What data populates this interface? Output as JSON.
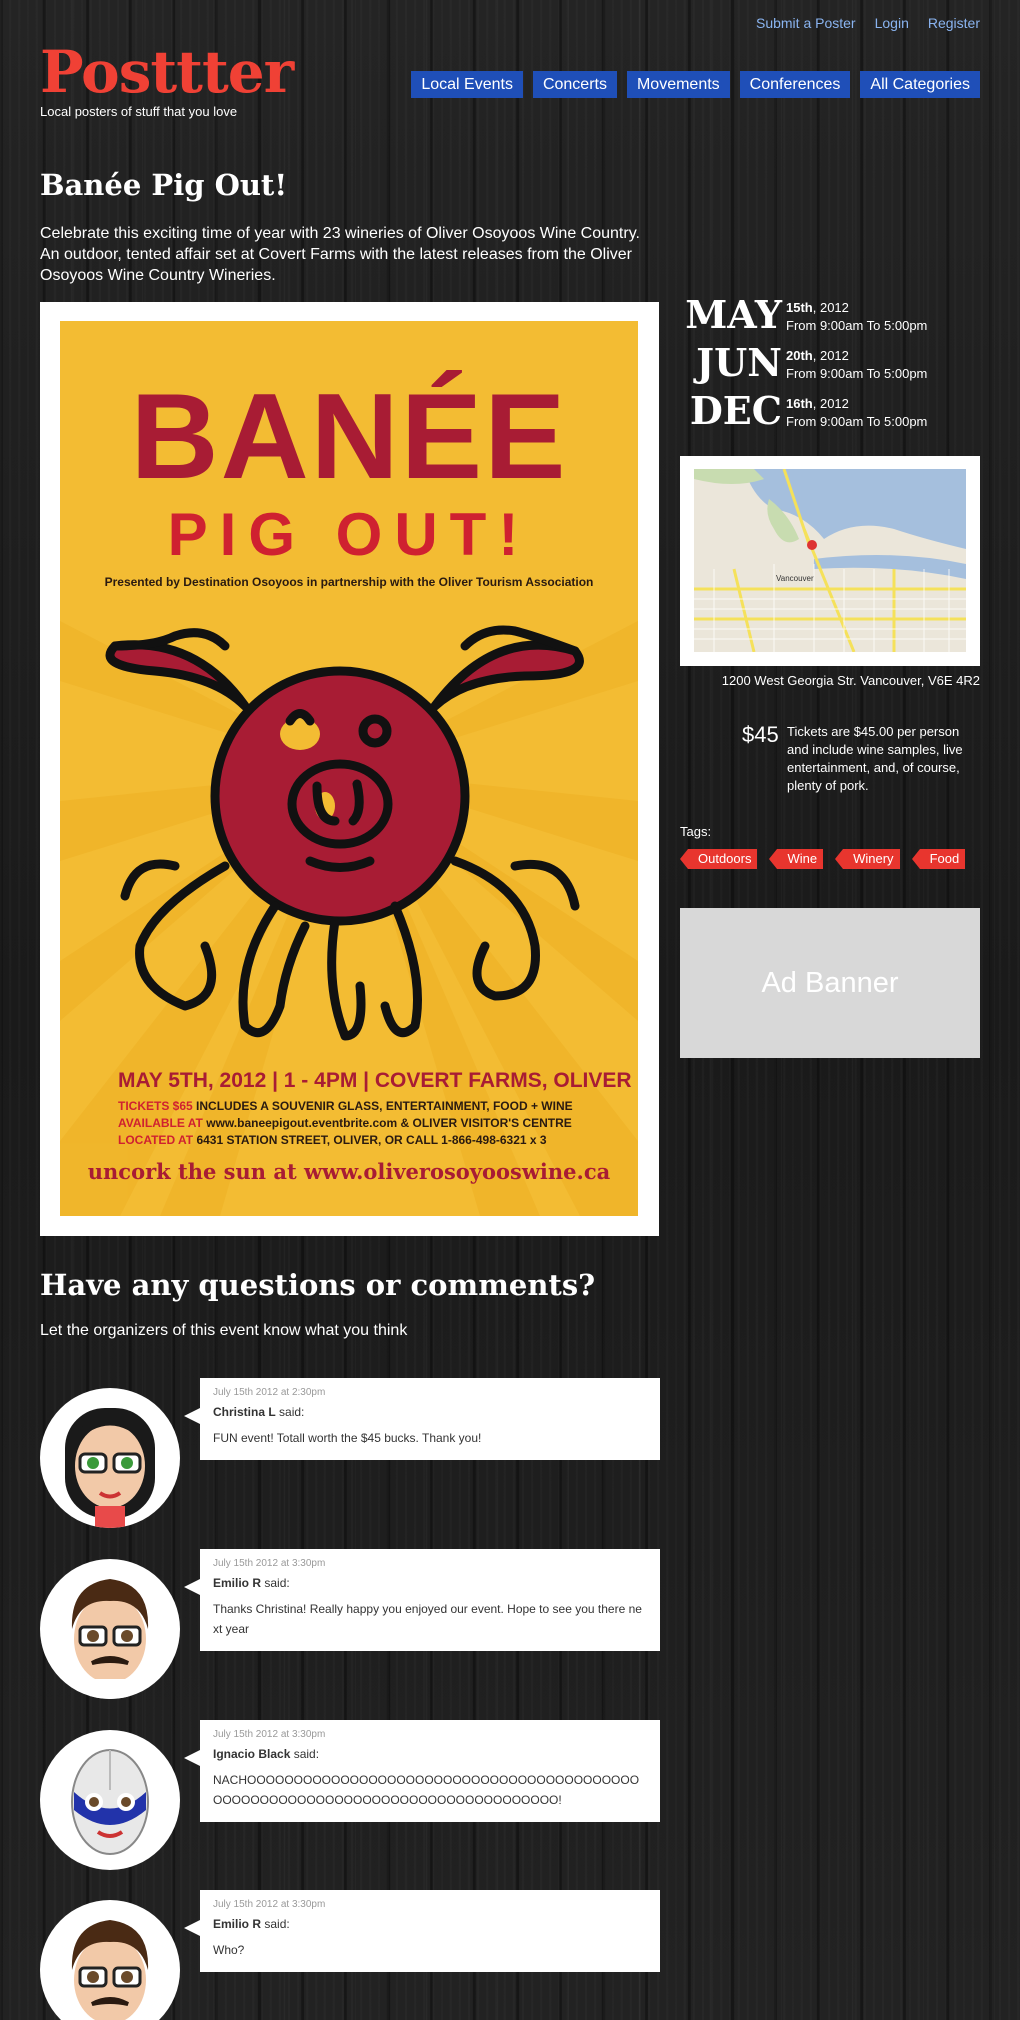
{
  "header": {
    "logo": "Posttter",
    "tagline": "Local posters of stuff that you love",
    "toplinks": [
      "Submit a Poster",
      "Login",
      "Register"
    ],
    "nav": [
      "Local Events",
      "Concerts",
      "Movements",
      "Conferences",
      "All Categories"
    ],
    "colors": {
      "logo": "#f04135",
      "nav": "#1f4fb8",
      "link": "#8ab4f0"
    }
  },
  "event": {
    "title": "Banée Pig Out!",
    "description": "Celebrate this exciting time of year with 23 wineries of Oliver Osoyoos Wine Country. An outdoor, tented affair set at Covert Farms with the latest releases from the Oliver Osoyoos Wine Country Wineries."
  },
  "poster": {
    "title": "BANÉE",
    "subtitle": "PIG OUT!",
    "presented": "Presented by Destination Osoyoos in partnership with the Oliver Tourism Association",
    "line1": "MAY 5TH, 2012 | 1 - 4PM | COVERT FARMS, OLIVER",
    "tickets_label": "TICKETS $65",
    "tickets_text": "INCLUDES A SOUVENIR GLASS, ENTERTAINMENT, FOOD + WINE",
    "available_label": "AVAILABLE AT",
    "available_text": "www.baneepigout.eventbrite.com & OLIVER VISITOR'S CENTRE",
    "located_label": "LOCATED AT",
    "located_text": "6431 STATION STREET, OLIVER, OR CALL 1-866-498-6321 x 3",
    "tagline": "uncork the sun at www.oliverosoyooswine.ca"
  },
  "dates": [
    {
      "month": "MAY",
      "day": "15th",
      "year": ", 2012",
      "time": "From 9:00am To 5:00pm"
    },
    {
      "month": "JUN",
      "day": "20th",
      "year": ", 2012",
      "time": "From 9:00am To 5:00pm"
    },
    {
      "month": "DEC",
      "day": "16th",
      "year": ", 2012",
      "time": "From 9:00am To 5:00pm"
    }
  ],
  "map": {
    "label": "Vancouver"
  },
  "address": "1200 West Georgia Str. Vancouver, V6E 4R2",
  "price": {
    "amount": "$45",
    "description": "Tickets are $45.00 per person and include wine samples, live entertainment, and, of course, plenty of pork."
  },
  "tags": {
    "label": "Tags:",
    "items": [
      "Outdoors",
      "Wine",
      "Winery",
      "Food"
    ]
  },
  "ad": "Ad Banner",
  "comments_section": {
    "title": "Have any questions or comments?",
    "subtitle": "Let the organizers of this event know what you think",
    "said": "said:",
    "items": [
      {
        "date": "July 15th 2012 at 2:30pm",
        "author": "Christina L",
        "text": "FUN event! Totall worth the $45 bucks. Thank you!",
        "avatar": "woman-with-glasses-avatar"
      },
      {
        "date": "July 15th 2012 at 3:30pm",
        "author": "Emilio R",
        "text": "Thanks Christina! Really happy you enjoyed our event. Hope to see you there next year",
        "avatar": "man-with-mustache-avatar"
      },
      {
        "date": "July 15th 2012 at 3:30pm",
        "author": "Ignacio Black",
        "text": "NACHOOOOOOOOOOOOOOOOOOOOOOOOOOOOOOOOOOOOOOOOOOOOOOOOOOOOOOOOOOOOOOOOOOOOOOOOOOOOOOO!",
        "avatar": "luchador-mask-avatar"
      },
      {
        "date": "July 15th 2012 at 3:30pm",
        "author": "Emilio R",
        "text": "Who?",
        "avatar": "man-with-mustache-avatar"
      }
    ]
  }
}
